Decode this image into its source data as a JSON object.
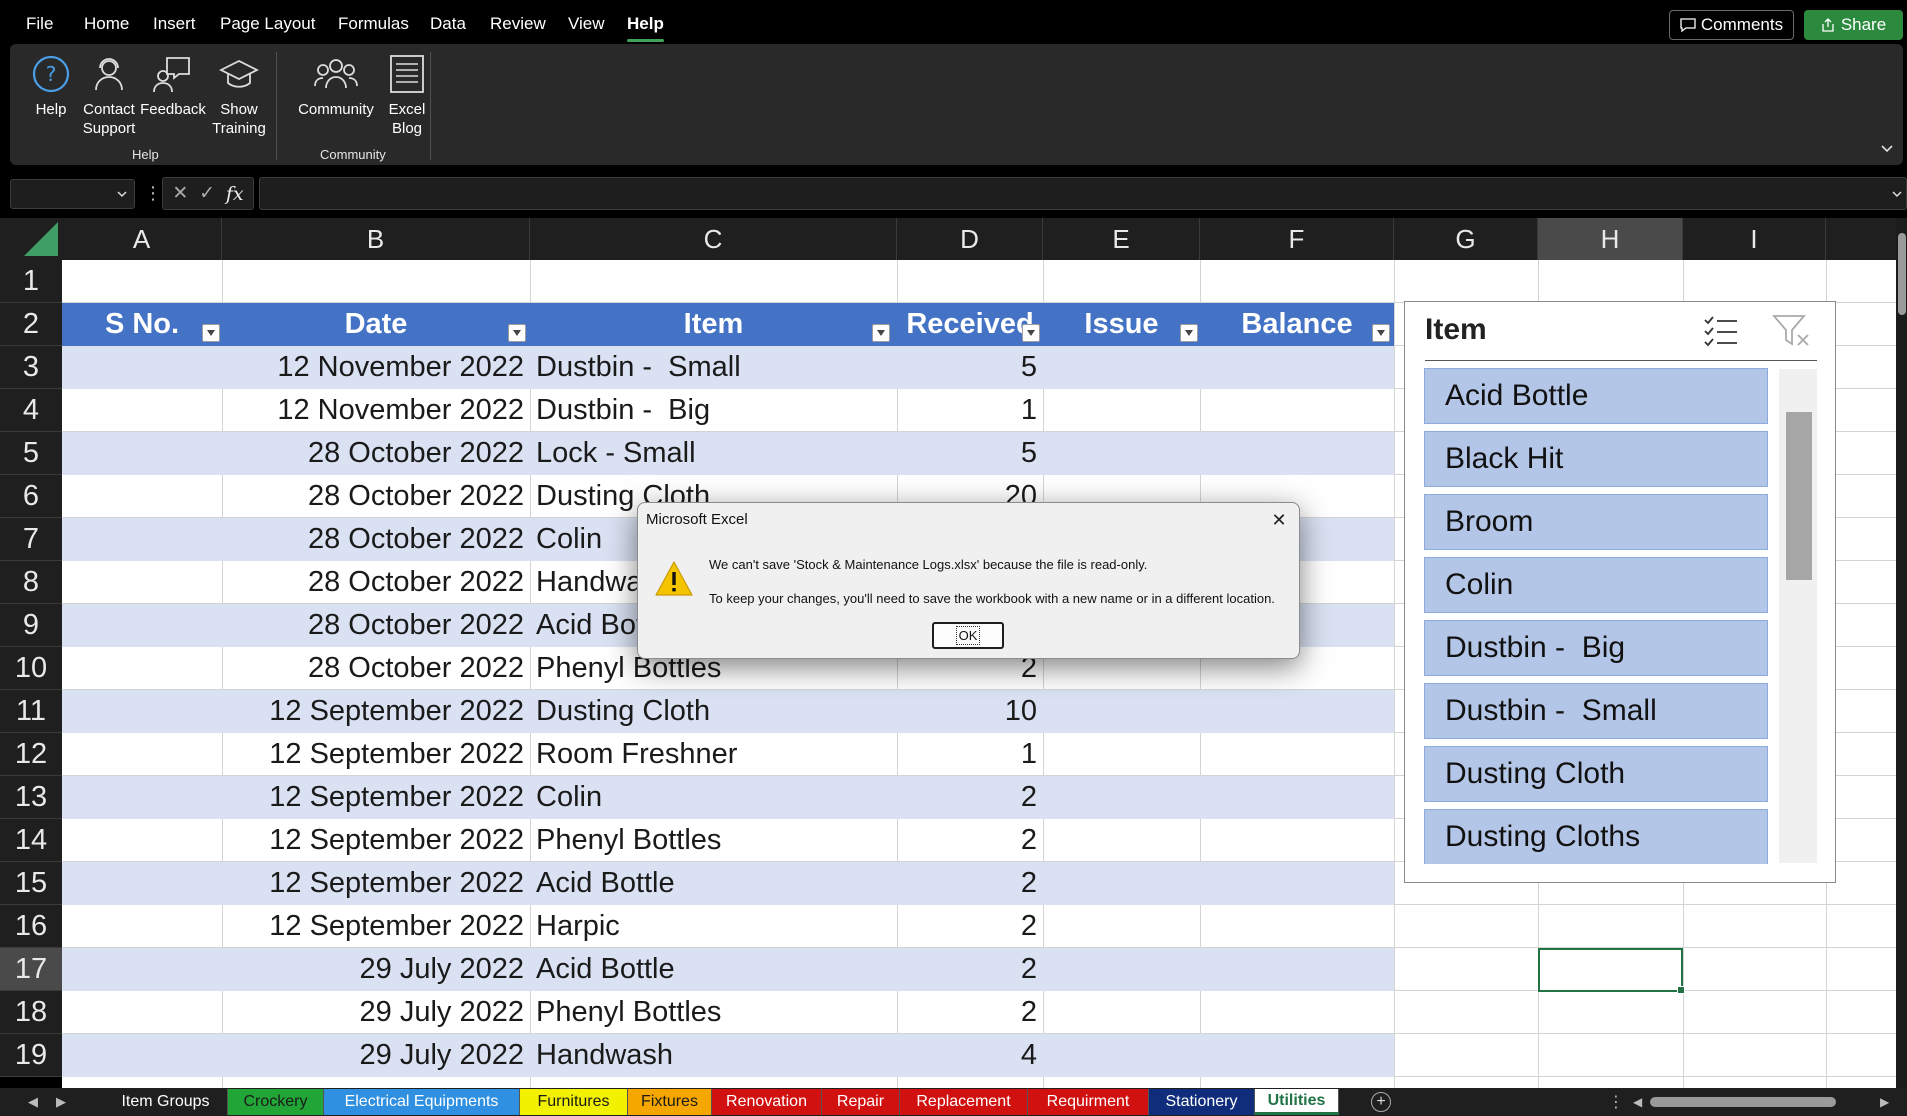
{
  "menu": {
    "items": [
      "File",
      "Home",
      "Insert",
      "Page Layout",
      "Formulas",
      "Data",
      "Review",
      "View",
      "Help"
    ],
    "active": "Help",
    "comments_label": "Comments",
    "share_label": "Share"
  },
  "ribbon": {
    "buttons": [
      {
        "label": "Help",
        "icon": "help-circle-icon"
      },
      {
        "label": "Contact\nSupport",
        "icon": "contact-support-icon"
      },
      {
        "label": "Feedback",
        "icon": "feedback-icon"
      },
      {
        "label": "Show\nTraining",
        "icon": "training-icon"
      },
      {
        "label": "Community",
        "icon": "community-icon"
      },
      {
        "label": "Excel\nBlog",
        "icon": "blog-icon"
      }
    ],
    "groups": [
      "Help",
      "Community"
    ]
  },
  "formula_bar": {
    "name_box": "",
    "fx_label": "fx",
    "value": ""
  },
  "columns": [
    "A",
    "B",
    "C",
    "D",
    "E",
    "F",
    "G",
    "H",
    "I"
  ],
  "selected_column": "H",
  "rows": [
    "1",
    "2",
    "3",
    "4",
    "5",
    "6",
    "7",
    "8",
    "9",
    "10",
    "11",
    "12",
    "13",
    "14",
    "15",
    "16",
    "17",
    "18",
    "19"
  ],
  "selected_row": "17",
  "table": {
    "headers": [
      "S No.",
      "Date",
      "Item",
      "Received",
      "Issue",
      "Balance"
    ],
    "rows": [
      {
        "date": "12 November 2022",
        "item": "Dustbin -  Small",
        "received": "5"
      },
      {
        "date": "12 November 2022",
        "item": "Dustbin -  Big",
        "received": "1"
      },
      {
        "date": "28 October 2022",
        "item": "Lock - Small",
        "received": "5"
      },
      {
        "date": "28 October 2022",
        "item": "Dusting Cloth",
        "received": "20"
      },
      {
        "date": "28 October 2022",
        "item": "Colin",
        "received": ""
      },
      {
        "date": "28 October 2022",
        "item": "Handwash",
        "received": ""
      },
      {
        "date": "28 October 2022",
        "item": "Acid Bottle",
        "received": ""
      },
      {
        "date": "28 October 2022",
        "item": "Phenyl Bottles",
        "received": "2"
      },
      {
        "date": "12 September 2022",
        "item": "Dusting Cloth",
        "received": "10"
      },
      {
        "date": "12 September 2022",
        "item": "Room Freshner",
        "received": "1"
      },
      {
        "date": "12 September 2022",
        "item": "Colin",
        "received": "2"
      },
      {
        "date": "12 September 2022",
        "item": "Phenyl Bottles",
        "received": "2"
      },
      {
        "date": "12 September 2022",
        "item": "Acid Bottle",
        "received": "2"
      },
      {
        "date": "12 September 2022",
        "item": "Harpic",
        "received": "2"
      },
      {
        "date": "29 July 2022",
        "item": "Acid Bottle",
        "received": "2"
      },
      {
        "date": "29 July 2022",
        "item": "Phenyl Bottles",
        "received": "2"
      },
      {
        "date": "29 July 2022",
        "item": "Handwash",
        "received": "4"
      }
    ]
  },
  "slicer": {
    "title": "Item",
    "items": [
      "Acid Bottle",
      "Black Hit",
      "Broom",
      "Colin",
      "Dustbin -  Big",
      "Dustbin -  Small",
      "Dusting Cloth",
      "Dusting Cloths"
    ]
  },
  "dialog": {
    "title": "Microsoft Excel",
    "message1": "We can't save 'Stock & Maintenance Logs.xlsx' because the file is read-only.",
    "message2": "To keep your changes, you'll need to save the workbook with a new name or in a different location.",
    "ok_label": "OK",
    "close_glyph": "✕"
  },
  "sheet_tabs": [
    {
      "label": "Item Groups",
      "color": "#1f1f1f",
      "text": "#ffffff"
    },
    {
      "label": "Crockery",
      "color": "#22a537",
      "text": "#1a1a1a"
    },
    {
      "label": "Electrical Equipments",
      "color": "#2f8fe0",
      "text": "#ffffff"
    },
    {
      "label": "Furnitures",
      "color": "#f2f200",
      "text": "#1a1a1a"
    },
    {
      "label": "Fixtures",
      "color": "#f5a700",
      "text": "#1a1a1a"
    },
    {
      "label": "Renovation",
      "color": "#d11010",
      "text": "#ffffff"
    },
    {
      "label": "Repair",
      "color": "#d11010",
      "text": "#ffffff"
    },
    {
      "label": "Replacement",
      "color": "#d11010",
      "text": "#ffffff"
    },
    {
      "label": "Requirment",
      "color": "#d11010",
      "text": "#ffffff"
    },
    {
      "label": "Stationery",
      "color": "#0f2d7a",
      "text": "#ffffff"
    },
    {
      "label": "Utilities",
      "color": "#ffffff",
      "text": "#217346"
    }
  ],
  "active_sheet": "Utilities",
  "colors": {
    "table_header": "#4472c4",
    "table_band": "#d9e1f2",
    "slicer_item": "#b4c6e7",
    "accent": "#217346"
  }
}
